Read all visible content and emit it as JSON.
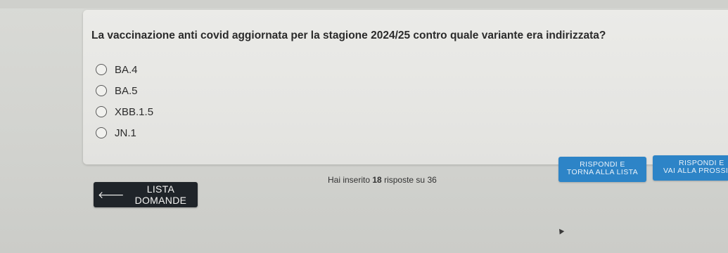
{
  "question": {
    "text": "La vaccinazione anti covid aggiornata per la stagione 2024/25 contro quale variante era indirizzata?",
    "options": [
      {
        "label": "BA.4"
      },
      {
        "label": "BA.5"
      },
      {
        "label": "XBB.1.5"
      },
      {
        "label": "JN.1"
      }
    ]
  },
  "progress": {
    "prefix": "Hai inserito",
    "answered": "18",
    "middle": "risposte su",
    "total": "36"
  },
  "nav": {
    "list_arrow": "🡐",
    "list_label": "LISTA DOMANDE",
    "back_line1": "RISPONDI E",
    "back_line2": "TORNA ALLA LISTA",
    "next_line1": "RISPONDI E",
    "next_line2": "VAI ALLA PROSSIMA"
  },
  "colors": {
    "primary_button": "#2d84c7",
    "dark_button": "#1f2429"
  }
}
